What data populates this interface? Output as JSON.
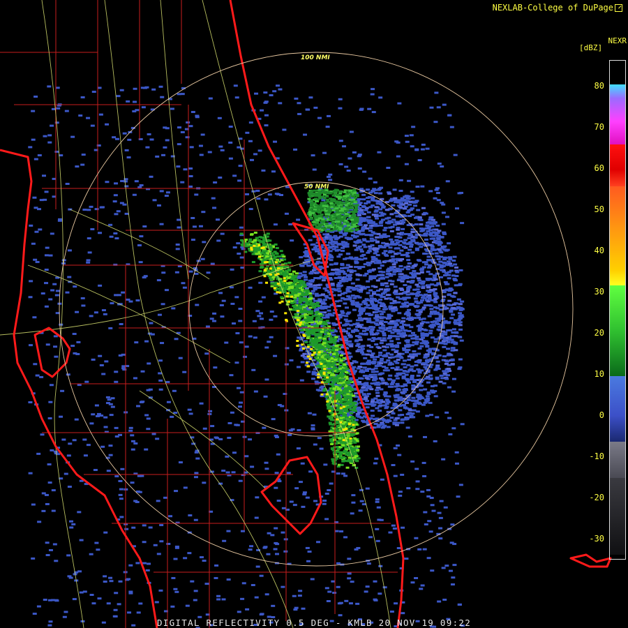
{
  "header": {
    "credit": "NEXLAB-College of DuPage",
    "product": "NEXR",
    "unit": "[dBZ]"
  },
  "rings": [
    "100 NMI",
    "50 NMI"
  ],
  "legend": {
    "ticks": [
      "80",
      "70",
      "60",
      "50",
      "40",
      "30",
      "20",
      "10",
      "0",
      "-10",
      "-20",
      "-30"
    ],
    "colors": {
      "low": "#404048",
      "negative": "#8a8a98",
      "weak": "#3f5bd0",
      "moderate": "#2a9a2a",
      "strong": "#ffe600",
      "severe": "#ff2020",
      "extreme": "#ff40ff",
      "max": "#40e0ff"
    }
  },
  "footer": {
    "title": "DIGITAL REFLECTIVITY 0.5 DEG - KMLB 20 NOV 19 09:22"
  },
  "map": {
    "county_color": "#c81e1e",
    "highway_color": "#d8e070",
    "coast_color": "#ff1a1a",
    "ring_color": "#e8c8a0"
  }
}
